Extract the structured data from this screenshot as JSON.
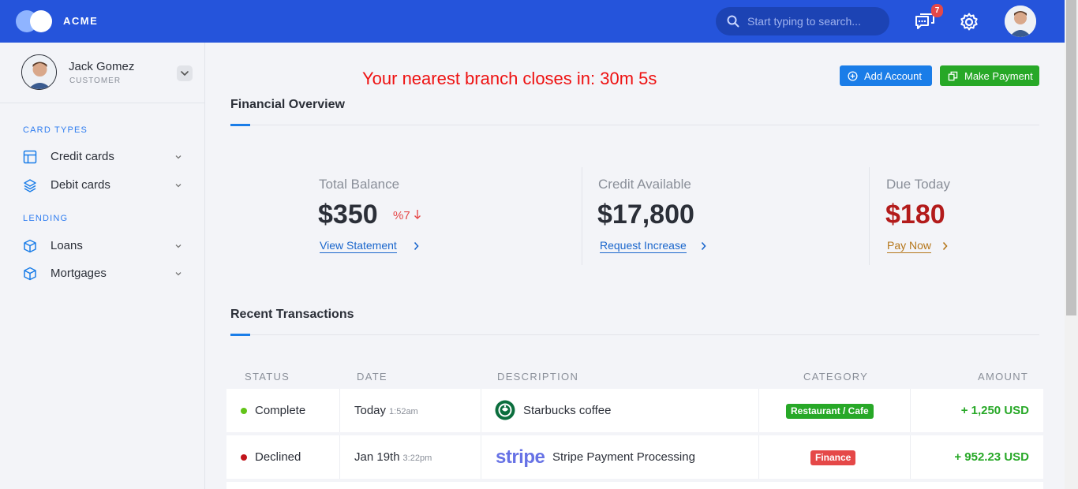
{
  "header": {
    "brand": "ACME",
    "search_placeholder": "Start typing to search...",
    "messages_count": "7",
    "icons": [
      "logo-icon",
      "search-icon",
      "chat-icon",
      "gear-icon",
      "avatar"
    ]
  },
  "sidebar": {
    "user_name": "Jack Gomez",
    "user_role": "CUSTOMER",
    "sections": [
      {
        "title": "CARD TYPES",
        "items": [
          {
            "label": "Credit cards",
            "icon": "table-icon"
          },
          {
            "label": "Debit cards",
            "icon": "layers-icon"
          }
        ]
      },
      {
        "title": "LENDING",
        "items": [
          {
            "label": "Loans",
            "icon": "box-icon"
          },
          {
            "label": "Mortgages",
            "icon": "box-icon"
          }
        ]
      }
    ]
  },
  "main": {
    "countdown": "Your nearest branch closes in: 30m 5s",
    "add_account": "Add Account",
    "make_payment": "Make Payment",
    "overview_title": "Financial Overview",
    "stats": [
      {
        "label": "Total Balance",
        "value": "$350",
        "trend": "%7",
        "link": "View Statement"
      },
      {
        "label": "Credit Available",
        "value": "$17,800",
        "link": "Request Increase"
      },
      {
        "label": "Due Today",
        "value": "$180",
        "link": "Pay Now"
      }
    ],
    "transactions_title": "Recent Transactions",
    "columns": [
      "STATUS",
      "DATE",
      "DESCRIPTION",
      "CATEGORY",
      "AMOUNT"
    ],
    "rows": [
      {
        "status": "Complete",
        "status_color": "#62c418",
        "date": "Today",
        "time": "1:52am",
        "description": "Starbucks coffee",
        "logo": "starbucks",
        "category": "Restaurant / Cafe",
        "category_color": "#27a827",
        "amount": "+ 1,250 USD"
      },
      {
        "status": "Declined",
        "status_color": "#c1141b",
        "date": "Jan 19th",
        "time": "3:22pm",
        "description": "Stripe Payment Processing",
        "logo": "stripe",
        "category": "Finance",
        "category_color": "#e54848",
        "amount": "+ 952.23 USD"
      }
    ]
  },
  "colors": {
    "topbar": "#2554db",
    "accent": "#1a7de8",
    "success": "#27a827",
    "danger": "#e54848",
    "due_red": "#b31b1b",
    "pay_link": "#b5761a"
  }
}
